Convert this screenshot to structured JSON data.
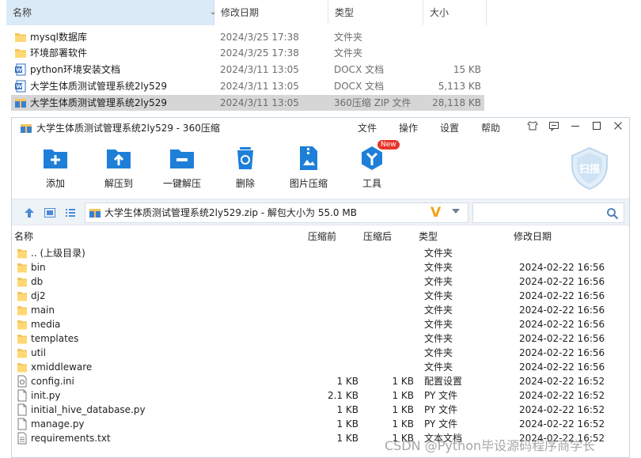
{
  "explorer": {
    "columns": {
      "name": "名称",
      "date": "修改日期",
      "type": "类型",
      "size": "大小"
    },
    "rows": [
      {
        "name": "mysql数据库",
        "date": "2024/3/25 17:38",
        "type": "文件夹",
        "size": "",
        "icon": "folder-icon"
      },
      {
        "name": "环境部署软件",
        "date": "2024/3/25 17:38",
        "type": "文件夹",
        "size": "",
        "icon": "folder-icon"
      },
      {
        "name": "python环境安装文档",
        "date": "2024/3/11 13:05",
        "type": "DOCX 文档",
        "size": "15 KB",
        "icon": "word-doc-icon"
      },
      {
        "name": "大学生体质测试管理系统2ly529",
        "date": "2024/3/11 13:05",
        "type": "DOCX 文档",
        "size": "5,113 KB",
        "icon": "word-doc-icon"
      },
      {
        "name": "大学生体质测试管理系统2ly529",
        "date": "2024/3/11 13:05",
        "type": "360压缩 ZIP 文件",
        "size": "28,118 KB",
        "icon": "zip-archive-icon"
      }
    ]
  },
  "archive": {
    "window_title": "大学生体质测试管理系统2ly529 - 360压缩",
    "menus": [
      "文件",
      "操作",
      "设置",
      "帮助"
    ],
    "toolbar": {
      "add": "添加",
      "extract_to": "解压到",
      "one_click": "一键解压",
      "delete": "删除",
      "image_compress": "图片压缩",
      "tools": "工具",
      "new_badge": "New",
      "scan": "扫描"
    },
    "address": "大学生体质测试管理系统2ly529.zip - 解包大小为 55.0 MB",
    "search_placeholder": "",
    "columns": {
      "name": "名称",
      "compressed_before": "压缩前",
      "compressed_after": "压缩后",
      "type": "类型",
      "modified": "修改日期"
    },
    "rows": [
      {
        "name": ".. (上级目录)",
        "pre": "",
        "post": "",
        "type": "文件夹",
        "modified": "",
        "icon": "folder-icon"
      },
      {
        "name": "bin",
        "pre": "",
        "post": "",
        "type": "文件夹",
        "modified": "2024-02-22 16:56",
        "icon": "folder-icon"
      },
      {
        "name": "db",
        "pre": "",
        "post": "",
        "type": "文件夹",
        "modified": "2024-02-22 16:56",
        "icon": "folder-icon"
      },
      {
        "name": "dj2",
        "pre": "",
        "post": "",
        "type": "文件夹",
        "modified": "2024-02-22 16:56",
        "icon": "folder-icon"
      },
      {
        "name": "main",
        "pre": "",
        "post": "",
        "type": "文件夹",
        "modified": "2024-02-22 16:56",
        "icon": "folder-icon"
      },
      {
        "name": "media",
        "pre": "",
        "post": "",
        "type": "文件夹",
        "modified": "2024-02-22 16:56",
        "icon": "folder-icon"
      },
      {
        "name": "templates",
        "pre": "",
        "post": "",
        "type": "文件夹",
        "modified": "2024-02-22 16:56",
        "icon": "folder-icon"
      },
      {
        "name": "util",
        "pre": "",
        "post": "",
        "type": "文件夹",
        "modified": "2024-02-22 16:56",
        "icon": "folder-icon"
      },
      {
        "name": "xmiddleware",
        "pre": "",
        "post": "",
        "type": "文件夹",
        "modified": "2024-02-22 16:56",
        "icon": "folder-icon"
      },
      {
        "name": "config.ini",
        "pre": "1 KB",
        "post": "1 KB",
        "type": "配置设置",
        "modified": "2024-02-22 16:52",
        "icon": "config-file-icon"
      },
      {
        "name": "init.py",
        "pre": "2.1 KB",
        "post": "1 KB",
        "type": "PY 文件",
        "modified": "2024-02-22 16:52",
        "icon": "file-icon"
      },
      {
        "name": "initial_hive_database.py",
        "pre": "1 KB",
        "post": "1 KB",
        "type": "PY 文件",
        "modified": "2024-02-22 16:52",
        "icon": "file-icon"
      },
      {
        "name": "manage.py",
        "pre": "1 KB",
        "post": "1 KB",
        "type": "PY 文件",
        "modified": "2024-02-22 16:52",
        "icon": "file-icon"
      },
      {
        "name": "requirements.txt",
        "pre": "1 KB",
        "post": "1 KB",
        "type": "文本文档",
        "modified": "2024-02-22 16:52",
        "icon": "text-file-icon"
      }
    ]
  },
  "watermark": "CSDN @Python毕设源码程序商学长"
}
